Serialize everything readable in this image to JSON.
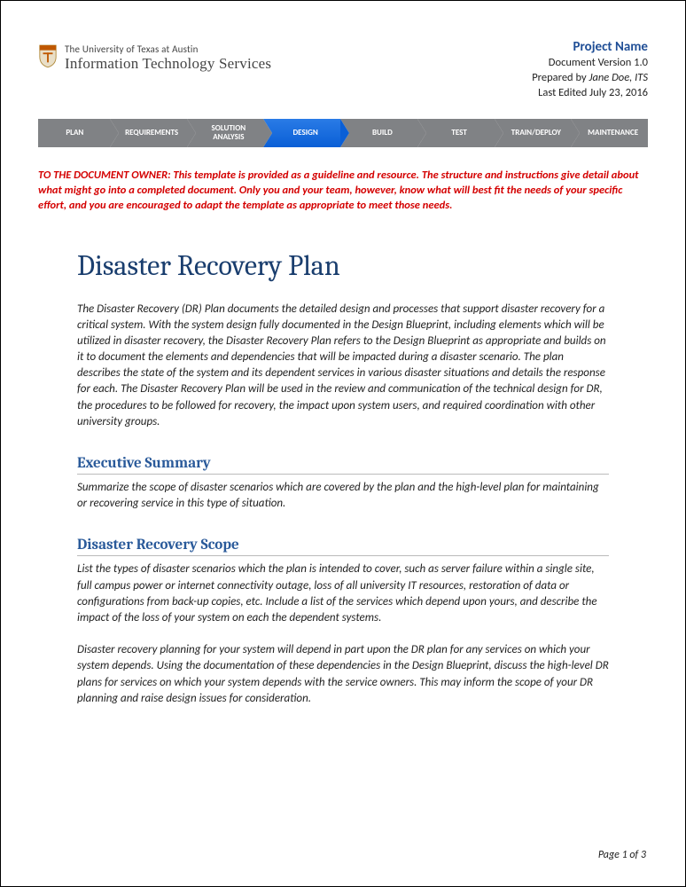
{
  "header": {
    "org_line1": "The University of Texas at Austin",
    "org_line2": "Information Technology Services",
    "project_name": "Project Name",
    "version": "Document Version 1.0",
    "prepared_by_prefix": "Prepared by ",
    "prepared_by_author": "Jane Doe, ITS",
    "last_edited": "Last Edited July 23, 2016"
  },
  "stepper": {
    "steps": [
      {
        "label": "PLAN",
        "active": false
      },
      {
        "label": "REQUIREMENTS",
        "active": false
      },
      {
        "label": "SOLUTION\nANALYSIS",
        "active": false
      },
      {
        "label": "DESIGN",
        "active": true
      },
      {
        "label": "BUILD",
        "active": false
      },
      {
        "label": "TEST",
        "active": false
      },
      {
        "label": "TRAIN/DEPLOY",
        "active": false
      },
      {
        "label": "MAINTENANCE",
        "active": false
      }
    ]
  },
  "owner_note": "TO THE DOCUMENT OWNER:  This template is provided as a guideline and resource. The structure and instructions give detail about what might go into a completed document. Only you and your team, however, know what will best fit the needs of your specific effort, and you are encouraged to adapt the template as appropriate to meet those needs.",
  "title": "Disaster Recovery Plan",
  "intro": "The Disaster Recovery (DR) Plan documents the detailed design and processes that support disaster recovery for a critical system.  With the system design fully documented in the Design Blueprint, including elements which will be utilized in disaster recovery, the Disaster Recovery Plan refers to the Design Blueprint as appropriate and builds on it to document the elements and dependencies that will be impacted during a disaster scenario.  The plan describes the state of the system and its dependent services in various disaster situations and details the response for each.  The Disaster Recovery Plan will be used in the review and communication of the technical design for DR, the procedures to be followed for recovery, the impact upon system users, and required coordination with other university groups.",
  "sections": {
    "exec_summary": {
      "heading": "Executive Summary",
      "body": "Summarize the scope of disaster scenarios which are covered by the plan and the high-level plan for maintaining or recovering service in this type of situation."
    },
    "scope": {
      "heading": "Disaster Recovery Scope",
      "p1": "List the types of disaster scenarios which the plan is intended to cover, such as server failure within a single site, full campus power or internet connectivity outage, loss of all university IT resources, restoration of data or configurations from back-up copies, etc.  Include a list of the services which depend upon yours, and describe the impact of the loss of your system on each the dependent systems.",
      "p2": "Disaster recovery planning for your system will depend in part upon the DR plan for any services on which your system depends.  Using the documentation of these dependencies in the Design Blueprint, discuss the high-level DR plans for services on which your system depends with the service owners.  This may inform the scope of your DR planning and raise design issues for consideration."
    }
  },
  "footer": "Page 1 of 3"
}
